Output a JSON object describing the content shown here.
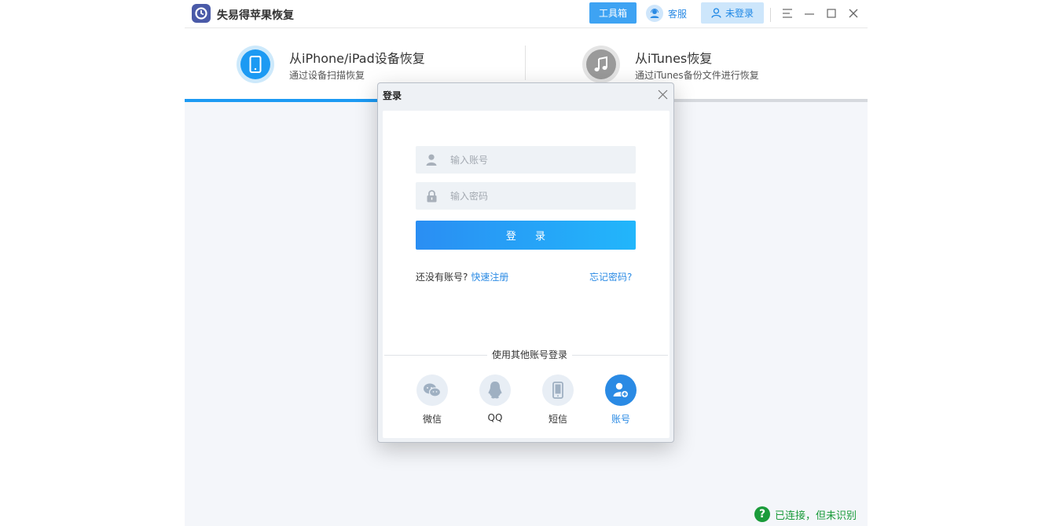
{
  "app": {
    "title": "失易得苹果恢复"
  },
  "header": {
    "toolbox_label": "工具箱",
    "service_label": "客服",
    "login_status_label": "未登录"
  },
  "tabs": [
    {
      "title": "从iPhone/iPad设备恢复",
      "subtitle": "通过设备扫描恢复",
      "active": true
    },
    {
      "title": "从iTunes恢复",
      "subtitle": "通过iTunes备份文件进行恢复",
      "active": false
    }
  ],
  "dialog": {
    "title": "登录",
    "account_placeholder": "输入账号",
    "password_placeholder": "输入密码",
    "login_button": "登 录",
    "no_account_text": "还没有账号?",
    "register_link": "快速注册",
    "forgot_link": "忘记密码?",
    "other_login_label": "使用其他账号登录",
    "alt_methods": [
      {
        "label": "微信",
        "icon": "wechat-icon"
      },
      {
        "label": "QQ",
        "icon": "qq-icon"
      },
      {
        "label": "短信",
        "icon": "phone-sms-icon"
      },
      {
        "label": "账号",
        "icon": "account-icon",
        "active": true
      }
    ]
  },
  "status": {
    "text": "已连接，但未识别"
  },
  "colors": {
    "accent": "#1c9af3",
    "link": "#2a8ae4",
    "status_green": "#1a9b3a"
  }
}
